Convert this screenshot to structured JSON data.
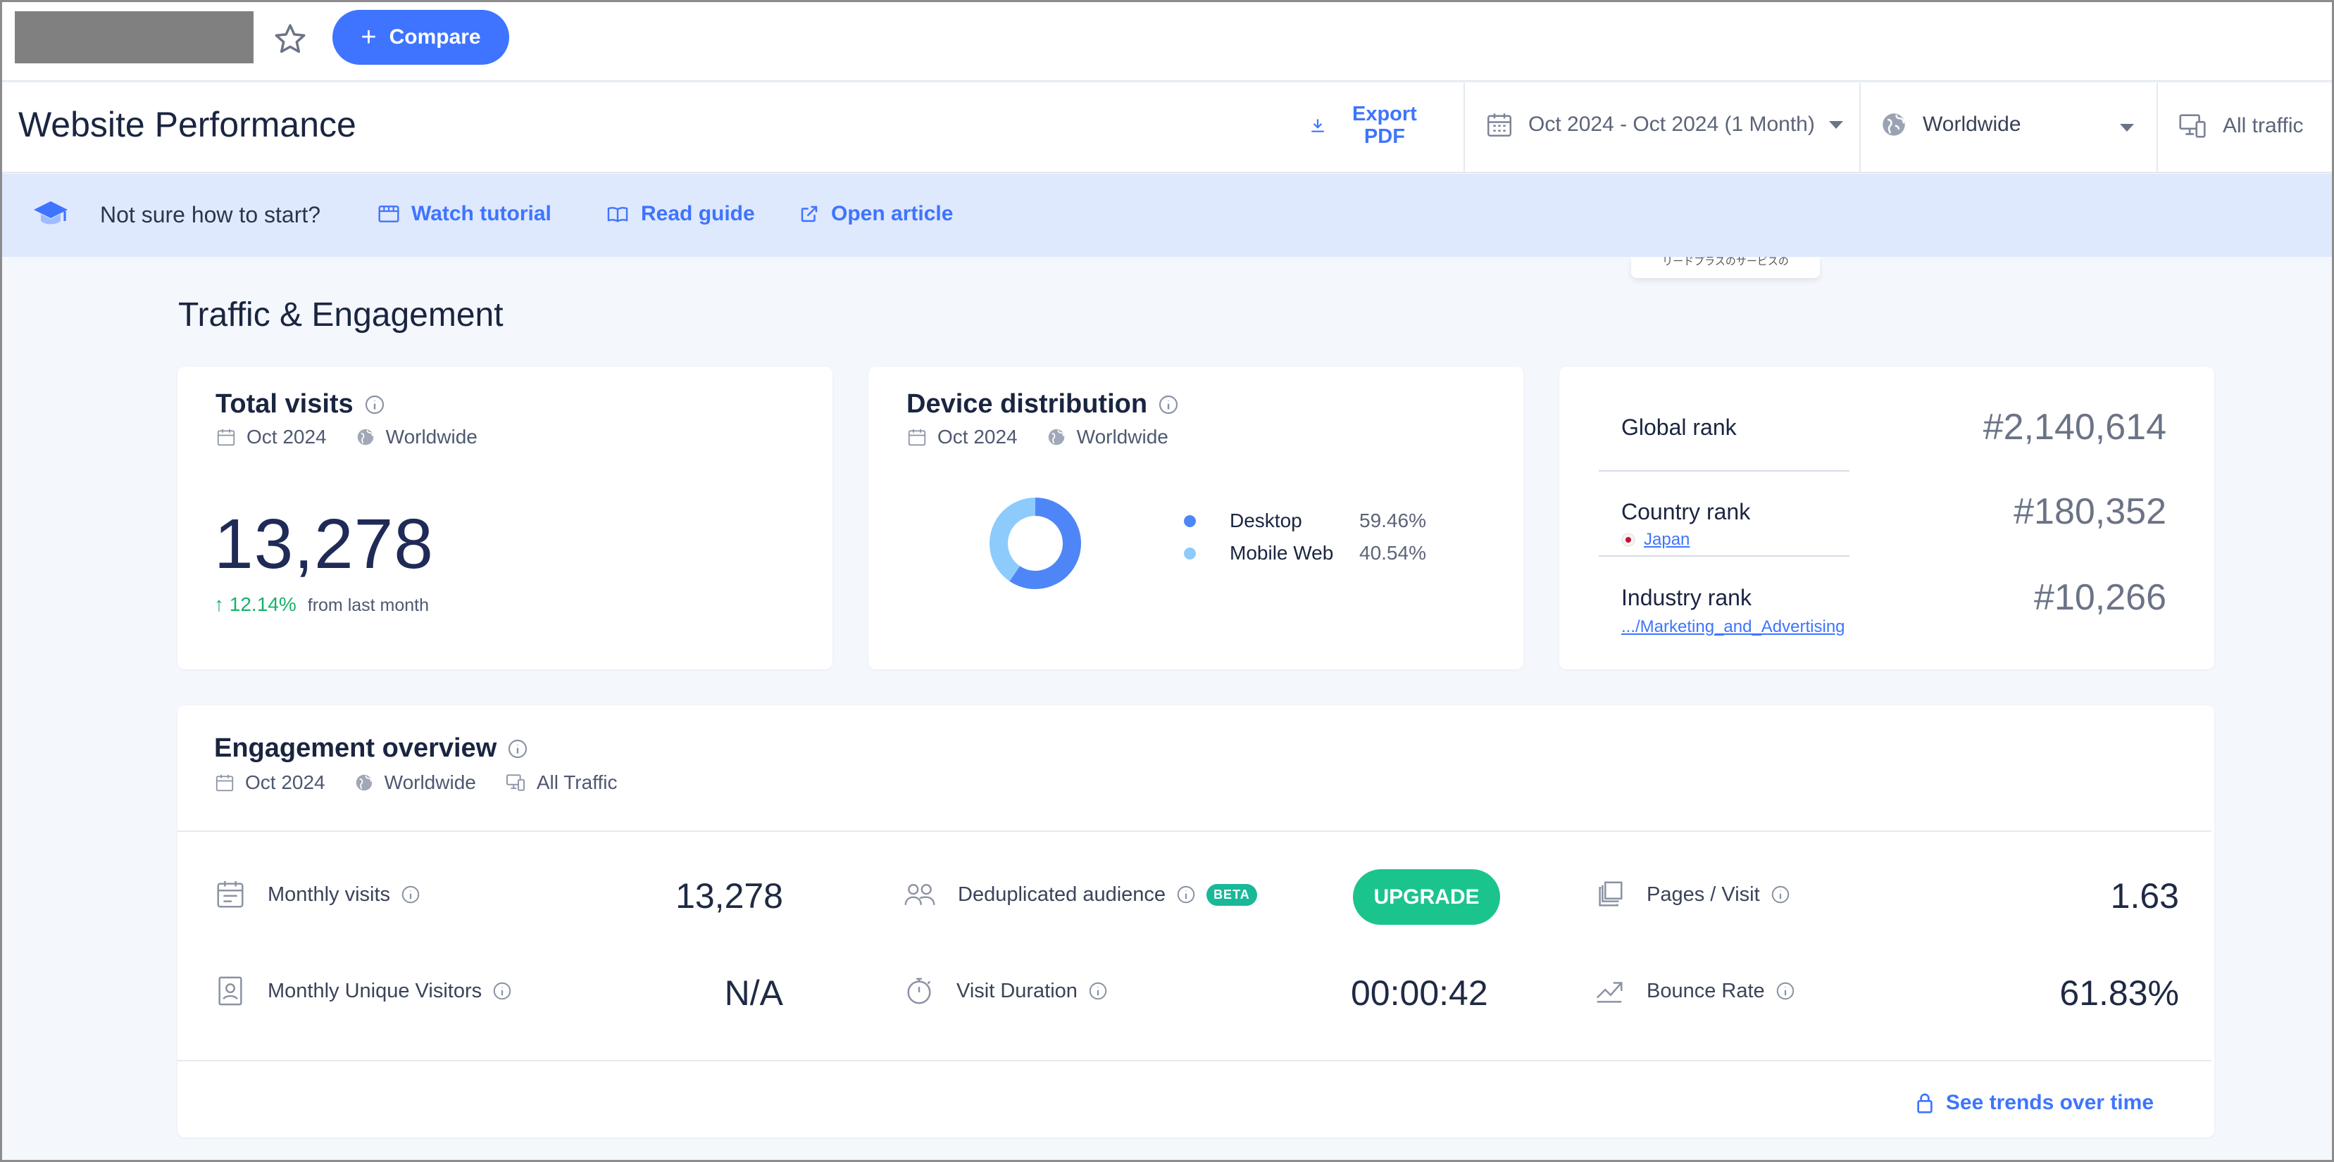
{
  "topbar": {
    "compare_label": "Compare"
  },
  "header": {
    "title": "Website Performance",
    "export_line1": "Export",
    "export_line2": "PDF",
    "date_range": "Oct 2024 - Oct 2024 (1 Month)",
    "geo": "Worldwide",
    "traffic": "All traffic"
  },
  "tutorial": {
    "prompt": "Not sure how to start?",
    "watch": "Watch tutorial",
    "read": "Read guide",
    "open": "Open article"
  },
  "popup_fragment": "リードプラスのサービスの",
  "section_title": "Traffic & Engagement",
  "total_visits": {
    "title": "Total visits",
    "date": "Oct 2024",
    "geo": "Worldwide",
    "value": "13,278",
    "change": "12.14%",
    "change_suffix": "from last month"
  },
  "device_distribution": {
    "title": "Device distribution",
    "date": "Oct 2024",
    "geo": "Worldwide",
    "items": [
      {
        "name": "Desktop",
        "share": 59.46,
        "label": "59.46%",
        "color": "#4f86f7"
      },
      {
        "name": "Mobile Web",
        "share": 40.54,
        "label": "40.54%",
        "color": "#8ecbfd"
      }
    ]
  },
  "ranks": {
    "global_label": "Global rank",
    "global_value": "#2,140,614",
    "country_label": "Country rank",
    "country_name": "Japan",
    "country_value": "#180,352",
    "industry_label": "Industry rank",
    "industry_name": ".../Marketing_and_Advertising",
    "industry_value": "#10,266"
  },
  "engagement": {
    "title": "Engagement overview",
    "date": "Oct 2024",
    "geo": "Worldwide",
    "traffic": "All Traffic",
    "monthly_visits_label": "Monthly visits",
    "monthly_visits_value": "13,278",
    "unique_label": "Monthly Unique Visitors",
    "unique_value": "N/A",
    "dedup_label": "Deduplicated audience",
    "beta_label": "BETA",
    "upgrade_label": "UPGRADE",
    "duration_label": "Visit Duration",
    "duration_value": "00:00:42",
    "pages_label": "Pages / Visit",
    "pages_value": "1.63",
    "bounce_label": "Bounce Rate",
    "bounce_value": "61.83%",
    "trends_label": "See trends over time"
  },
  "colors": {
    "accent": "#3e74ff",
    "upgrade": "#1cc48d",
    "positive": "#17b26a"
  }
}
